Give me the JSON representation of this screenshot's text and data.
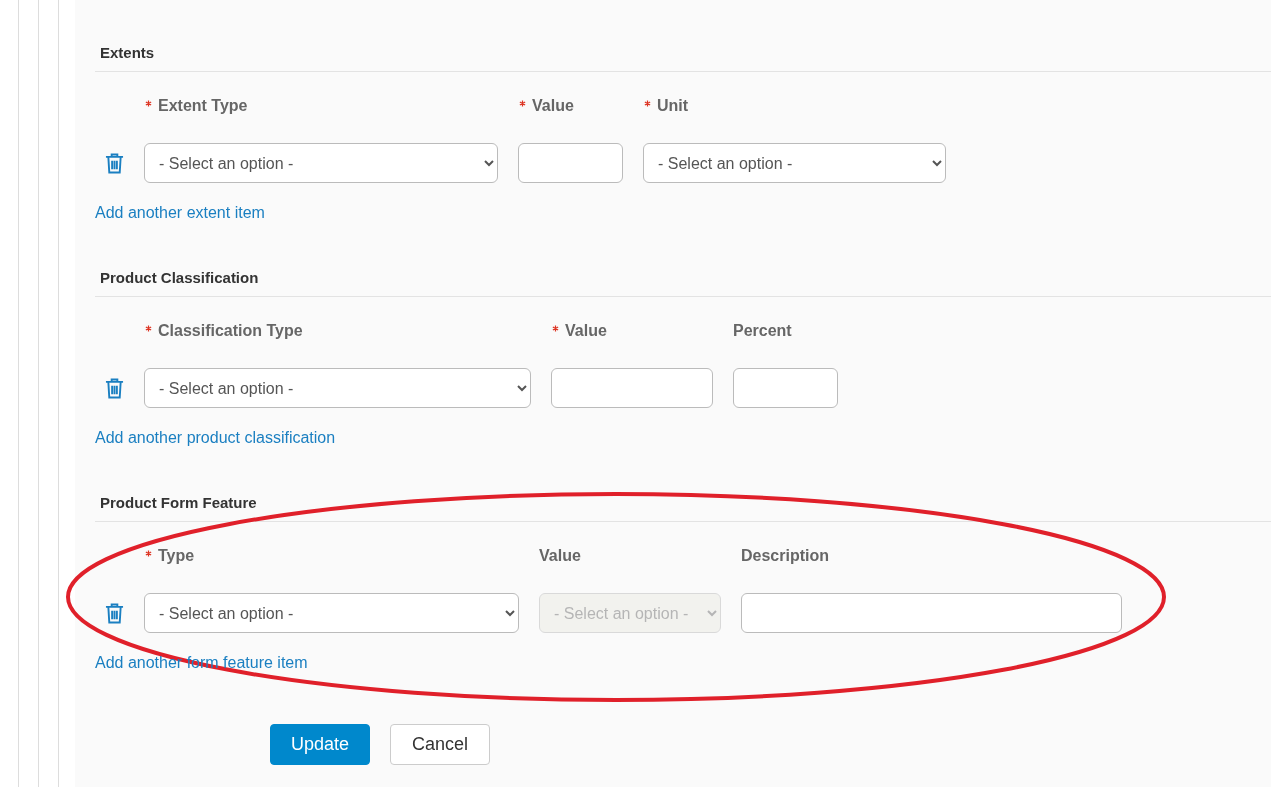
{
  "sections": [
    {
      "title": "Extents",
      "fields": [
        {
          "kind": "select",
          "label": "Extent Type",
          "required": true,
          "placeholder": "- Select an option -",
          "disabled": false
        },
        {
          "kind": "input",
          "label": "Value",
          "required": true,
          "disabled": false
        },
        {
          "kind": "select",
          "label": "Unit",
          "required": true,
          "placeholder": "- Select an option -",
          "disabled": false
        }
      ],
      "add_link": "Add another extent item"
    },
    {
      "title": "Product Classification",
      "fields": [
        {
          "kind": "select",
          "label": "Classification Type",
          "required": true,
          "placeholder": "- Select an option -",
          "disabled": false
        },
        {
          "kind": "input",
          "label": "Value",
          "required": true,
          "disabled": false
        },
        {
          "kind": "input",
          "label": "Percent",
          "required": false,
          "disabled": false
        }
      ],
      "add_link": "Add another product classification"
    },
    {
      "title": "Product Form Feature",
      "fields": [
        {
          "kind": "select",
          "label": "Type",
          "required": true,
          "placeholder": "- Select an option -",
          "disabled": false
        },
        {
          "kind": "select",
          "label": "Value",
          "required": false,
          "placeholder": "- Select an option -",
          "disabled": true
        },
        {
          "kind": "input",
          "label": "Description",
          "required": false,
          "disabled": false
        }
      ],
      "add_link": "Add another form feature item"
    }
  ],
  "buttons": [
    {
      "label": "Update",
      "kind": "primary"
    },
    {
      "label": "Cancel",
      "kind": "secondary"
    }
  ],
  "annotations": [
    {
      "kind": "ellipse",
      "color": "#e0202a"
    }
  ]
}
